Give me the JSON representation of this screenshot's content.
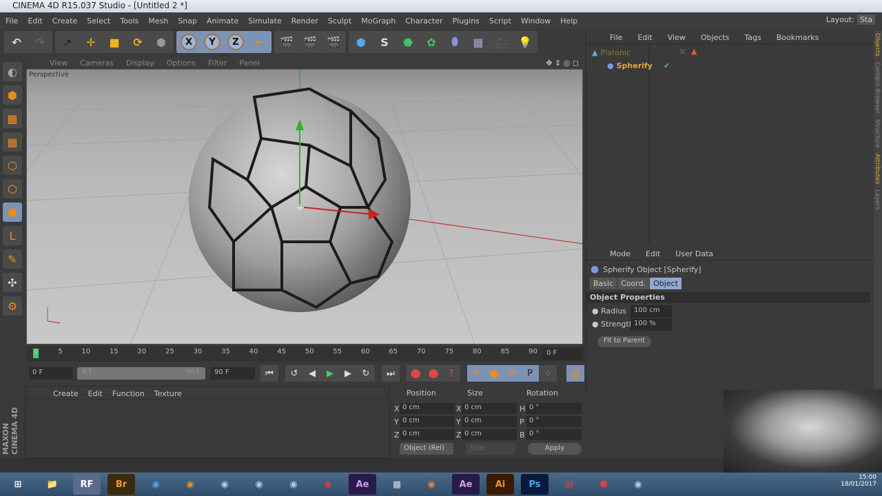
{
  "window": {
    "title": "CINEMA 4D R15.037 Studio - [Untitled 2 *]",
    "layout_label": "Layout:",
    "layout_value": "Sta"
  },
  "menu": [
    "File",
    "Edit",
    "Create",
    "Select",
    "Tools",
    "Mesh",
    "Snap",
    "Animate",
    "Simulate",
    "Render",
    "Sculpt",
    "MoGraph",
    "Character",
    "Plugins",
    "Script",
    "Window",
    "Help"
  ],
  "viewport": {
    "menu": [
      "View",
      "Cameras",
      "Display",
      "Options",
      "Filter",
      "Panel"
    ],
    "label": "Perspective"
  },
  "timeline": {
    "ticks": [
      "0",
      "5",
      "10",
      "15",
      "20",
      "25",
      "30",
      "35",
      "40",
      "45",
      "50",
      "55",
      "60",
      "65",
      "70",
      "75",
      "80",
      "85",
      "90"
    ],
    "current_frame": "0 F",
    "start": "0 F",
    "range_start": "0 F",
    "range_end": "90 F",
    "end": "90 F"
  },
  "material_manager": {
    "menu": [
      "Create",
      "Edit",
      "Function",
      "Texture"
    ]
  },
  "coordinates": {
    "headers": [
      "Position",
      "Size",
      "Rotation"
    ],
    "rows": [
      {
        "a": "X",
        "p": "0 cm",
        "b": "X",
        "s": "0 cm",
        "c": "H",
        "r": "0 °"
      },
      {
        "a": "Y",
        "p": "0 cm",
        "b": "Y",
        "s": "0 cm",
        "c": "P",
        "r": "0 °"
      },
      {
        "a": "Z",
        "p": "0 cm",
        "b": "Z",
        "s": "0 cm",
        "c": "B",
        "r": "0 °"
      }
    ],
    "mode": "Object (Rel)",
    "size_mode": "Size",
    "apply": "Apply"
  },
  "object_manager": {
    "menu": [
      "File",
      "Edit",
      "View",
      "Objects",
      "Tags",
      "Bookmarks"
    ],
    "objects": [
      {
        "name": "Platonic"
      },
      {
        "name": "Spherify"
      }
    ]
  },
  "attributes": {
    "menu": [
      "Mode",
      "Edit",
      "User Data"
    ],
    "title": "Spherify Object [Spherify]",
    "tabs": [
      "Basic",
      "Coord.",
      "Object"
    ],
    "section": "Object Properties",
    "fields": [
      {
        "label": "Radius",
        "value": "100 cm"
      },
      {
        "label": "Strength",
        "value": "100 %"
      }
    ],
    "fit_button": "Fit to Parent"
  },
  "side_tabs": [
    "Objects",
    "Content Browser",
    "Structure",
    "Attributes",
    "Layers"
  ],
  "logo": "MAXON CINEMA 4D",
  "taskbar": {
    "apps": [
      "RF",
      "Br",
      "Ae",
      "Ai",
      "Ps"
    ]
  },
  "clock": {
    "time": "15:00",
    "date": "18/01/2017"
  },
  "colors": {
    "accent": "#7d93b5",
    "object_name": "#d9a43a",
    "bg": "#3a3a3a"
  }
}
